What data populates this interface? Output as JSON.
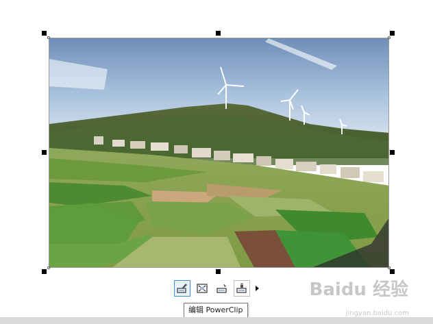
{
  "toolbar": {
    "buttons": [
      {
        "icon": "edit-powerclip-icon",
        "active": true
      },
      {
        "icon": "extract-contents-icon",
        "active": false
      },
      {
        "icon": "select-contents-icon",
        "active": false
      },
      {
        "icon": "lock-contents-icon",
        "active": false
      }
    ],
    "more_icon": "chevron-right-icon"
  },
  "tooltip": {
    "text": "编辑 PowerClip"
  },
  "watermark": {
    "logo": "Baidu 经验",
    "url": "jingyan.baidu.com"
  },
  "colors": {
    "selection_handle": "#000000",
    "active_button_border": "#3b8fd8",
    "sky": "#9ab6d6",
    "field_green": "#5f8f3a"
  }
}
